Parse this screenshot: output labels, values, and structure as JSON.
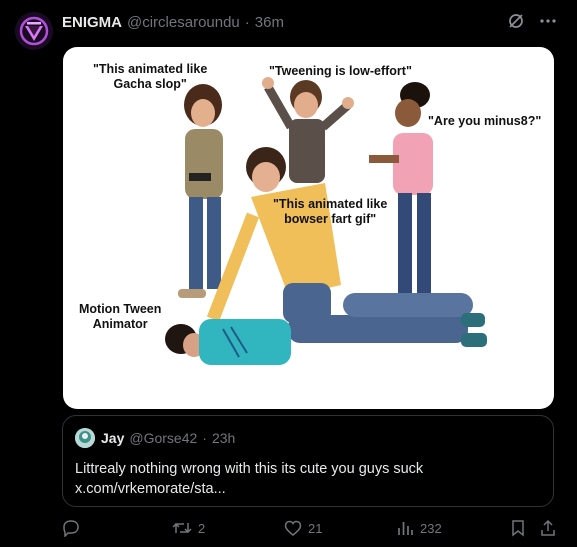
{
  "post": {
    "author_name": "ENIGMA",
    "author_handle": "@circlesaroundu",
    "separator": "·",
    "time": "36m"
  },
  "meme": {
    "captions": {
      "top_left": [
        "\"This animated  like",
        "Gacha slop\""
      ],
      "top_center": "\"Tweening is low-effort\"",
      "top_right": "\"Are you minus8?\"",
      "center": [
        "\"This animated like",
        "bowser fart gif\""
      ],
      "bottom_left": [
        "Motion Tween",
        "Animator"
      ]
    },
    "shirt_text": "Motion Tween"
  },
  "quote": {
    "author_name": "Jay",
    "author_handle": "@Gorse42",
    "separator": "·",
    "time": "23h",
    "text_line1": "Littrealy nothing wrong with this its cute you guys suck",
    "text_line2": "x.com/vrkemorate/sta..."
  },
  "actions": {
    "retweets": "2",
    "likes": "21",
    "views": "232"
  },
  "icons": [
    "grok-icon",
    "more-icon",
    "reply-icon",
    "retweet-icon",
    "like-icon",
    "views-icon",
    "bookmark-icon",
    "share-icon"
  ]
}
